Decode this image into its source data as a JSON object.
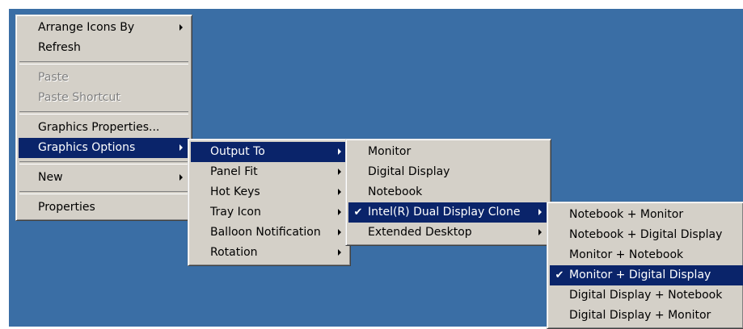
{
  "desktop_menu": {
    "items": [
      {
        "label": "Arrange Icons By"
      },
      {
        "label": "Refresh"
      },
      {
        "label": "Paste"
      },
      {
        "label": "Paste Shortcut"
      },
      {
        "label": "Graphics Properties..."
      },
      {
        "label": "Graphics Options"
      },
      {
        "label": "New"
      },
      {
        "label": "Properties"
      }
    ]
  },
  "graphics_options_menu": {
    "items": [
      {
        "label": "Output To"
      },
      {
        "label": "Panel Fit"
      },
      {
        "label": "Hot Keys"
      },
      {
        "label": "Tray Icon"
      },
      {
        "label": "Balloon Notification"
      },
      {
        "label": "Rotation"
      }
    ]
  },
  "output_to_menu": {
    "items": [
      {
        "label": "Monitor"
      },
      {
        "label": "Digital Display"
      },
      {
        "label": "Notebook"
      },
      {
        "label": "Intel(R) Dual Display Clone"
      },
      {
        "label": "Extended Desktop"
      }
    ]
  },
  "clone_menu": {
    "items": [
      {
        "label": "Notebook + Monitor"
      },
      {
        "label": "Notebook + Digital Display"
      },
      {
        "label": "Monitor + Notebook"
      },
      {
        "label": "Monitor + Digital Display"
      },
      {
        "label": "Digital Display + Notebook"
      },
      {
        "label": "Digital Display + Monitor"
      }
    ]
  },
  "glyphs": {
    "check": "✔"
  },
  "colors": {
    "desktop_bg": "#3a6ea5",
    "menu_bg": "#d4d0c8",
    "highlight_bg": "#0a246a",
    "highlight_fg": "#ffffff",
    "disabled_fg": "#808080"
  }
}
